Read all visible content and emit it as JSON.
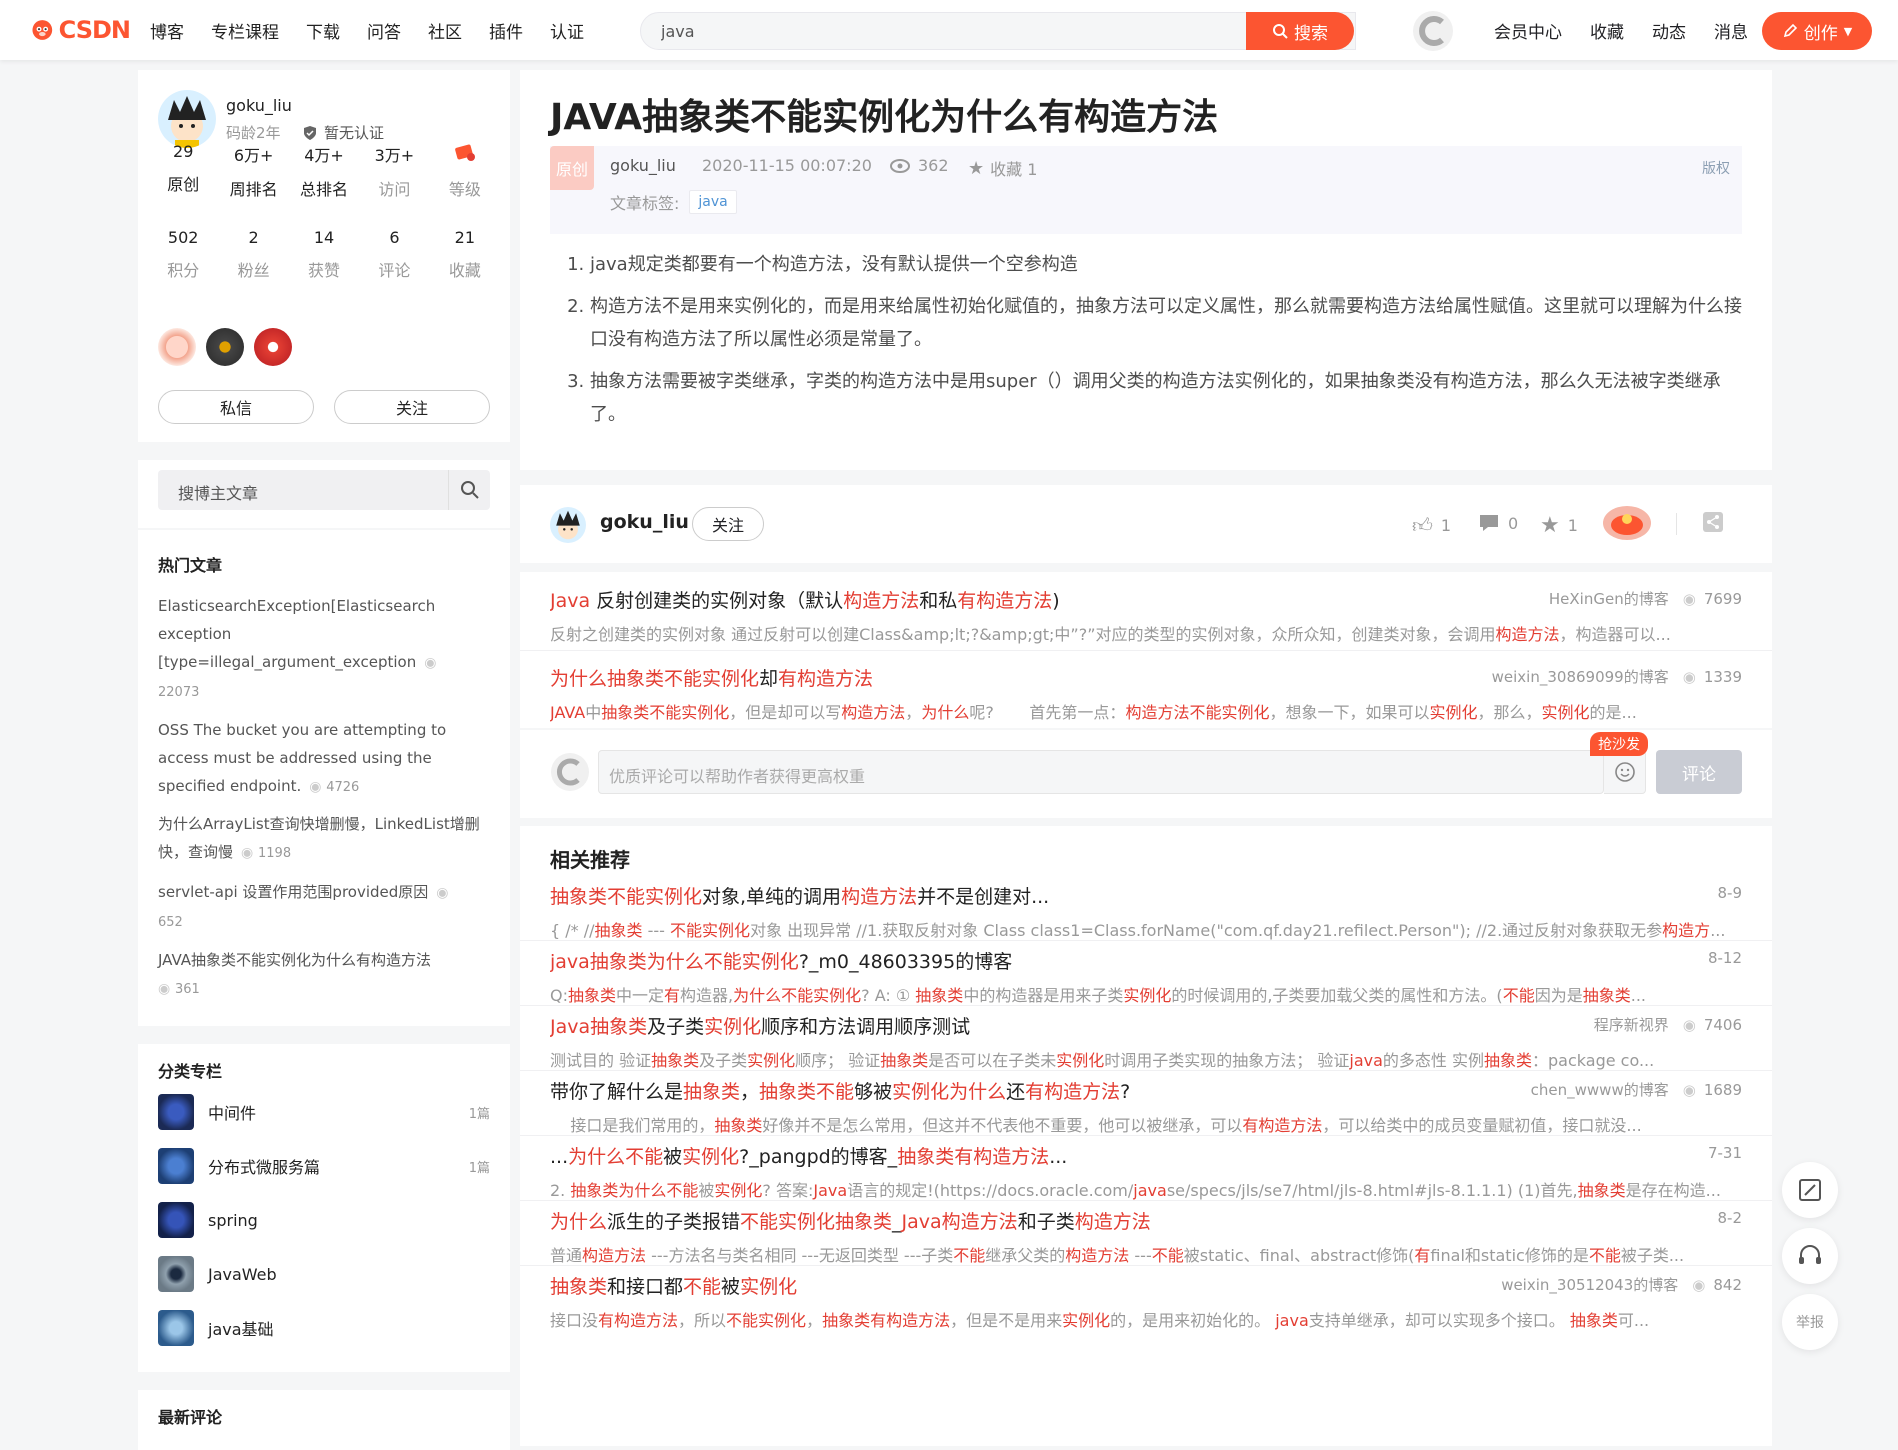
{
  "topbar": {
    "logo_text": "CSDN",
    "nav": [
      "博客",
      "专栏课程",
      "下载",
      "问答",
      "社区",
      "插件",
      "认证"
    ],
    "search_value": "java",
    "search_button": "搜索",
    "links": [
      "会员中心",
      "收藏",
      "动态",
      "消息"
    ],
    "create_button": "创作"
  },
  "profile": {
    "name": "goku_liu",
    "years": "码龄2年",
    "cert": "暂无认证",
    "stats1": [
      {
        "n": "29",
        "l": "原创"
      },
      {
        "n": "6万+",
        "l": "周排名"
      },
      {
        "n": "4万+",
        "l": "总排名"
      },
      {
        "n": "3万+",
        "l": "访问"
      },
      {
        "n": "",
        "l": "等级"
      }
    ],
    "stats2": [
      {
        "n": "502",
        "l": "积分"
      },
      {
        "n": "2",
        "l": "粉丝"
      },
      {
        "n": "14",
        "l": "获赞"
      },
      {
        "n": "6",
        "l": "评论"
      },
      {
        "n": "21",
        "l": "收藏"
      }
    ],
    "message_button": "私信",
    "follow_button": "关注"
  },
  "blogger_search": {
    "placeholder": "搜博主文章"
  },
  "hot_articles": {
    "title": "热门文章",
    "items": [
      {
        "title": "ElasticsearchException[Elasticsearch exception [type=illegal_argument_exception",
        "views": "22073"
      },
      {
        "title": "OSS The bucket you are attempting to access must be addressed using the specified endpoint.",
        "views": "4726"
      },
      {
        "title": "为什么ArrayList查询快增删慢，LinkedList增删快，查询慢",
        "views": "1198"
      },
      {
        "title": "servlet-api 设置作用范围provided原因",
        "views": "652"
      },
      {
        "title": "JAVA抽象类不能实例化为什么有构造方法",
        "views": "361"
      }
    ]
  },
  "categories": {
    "title": "分类专栏",
    "items": [
      {
        "name": "中间件",
        "count": "1篇",
        "color": "#1b2a55"
      },
      {
        "name": "分布式微服务篇",
        "count": "1篇",
        "color": "#1d3f74"
      },
      {
        "name": "spring",
        "count": "",
        "color": "#13214a"
      },
      {
        "name": "JavaWeb",
        "count": "",
        "color": "#6b7a86"
      },
      {
        "name": "java基础",
        "count": "",
        "color": "#2c5b8c"
      }
    ]
  },
  "latest_comments": {
    "title": "最新评论"
  },
  "article": {
    "title": "JAVA抽象类不能实例化为什么有构造方法",
    "badge": "原创",
    "author": "goku_liu",
    "date": "2020-11-15 00:07:20",
    "views": "362",
    "favorites": "收藏 1",
    "copyright": "版权",
    "tags_label": "文章标签:",
    "tag": "java",
    "paragraphs": [
      "java规定类都要有一个构造方法，没有默认提供一个空参构造",
      "构造方法不是用来实例化的，而是用来给属性初始化赋值的，抽象方法可以定义属性，那么就需要构造方法给属性赋值。这里就可以理解为什么接口没有构造方法了所以属性必须是常量了。",
      "抽象方法需要被字类继承，字类的构造方法中是用super（）调用父类的构造方法实例化的，如果抽象类没有构造方法，那么久无法被字类继承了。"
    ]
  },
  "toolbar": {
    "author": "goku_liu",
    "follow": "关注",
    "likes": "1",
    "comments": "0",
    "favorites": "1"
  },
  "related_top": [
    {
      "title_html": "<span class='hl'>Java</span> 反射创建类的实例对象（默认<span class='hl'>构造方法</span>和私<span class='hl'>有构造方法</span>)",
      "source": "HeXinGen的博客",
      "views": "7699",
      "desc_html": "反射之创建类的实例对象 通过反射可以创建Class&amp;amp;lt;?&amp;amp;gt;中”?”对应的类型的实例对象，众所众知，创建类对象，会调用<span class='hl'>构造方法</span>，构造器可以..."
    },
    {
      "title_html": "<span class='hl'>为什么抽象类不能实例化</span>却<span class='hl'>有构造方法</span>",
      "source": "weixin_30869099的博客",
      "views": "1339",
      "desc_html": "<span class='hl'>JAVA</span>中<span class='hl'>抽象类不能实例化</span>，但是却可以写<span class='hl'>构造方法</span>，<span class='hl'>为什么</span>呢?&nbsp;&nbsp;&nbsp;&nbsp;&nbsp;&nbsp;&nbsp;首先第一点：<span class='hl'>构造方法不能实例化</span>，想象一下，如果可以<span class='hl'>实例化</span>，那么，<span class='hl'>实例化</span>的是..."
    }
  ],
  "comment_box": {
    "placeholder": "优质评论可以帮助作者获得更高权重",
    "sofa": "抢沙发",
    "submit": "评论"
  },
  "recommend": {
    "title": "相关推荐",
    "items": [
      {
        "title_html": "<span class='hl'>抽象类不能实例化</span>对象,单纯的调用<span class='hl'>构造方法</span>并不是创建对...",
        "meta": "8-9",
        "views": "",
        "desc_html": "{ /* //<span class='hl'>抽象类</span> --- <span class='hl'>不能实例化</span>对象 出现异常 //1.获取反射对象 Class class1=Class.forName(\"com.qf.day21.refilect.Person\"); //2.通过反射对象获取无参<span class='hl'>构造方</span>..."
      },
      {
        "title_html": "<span class='hl'>java抽象类为什么不能实例化</span>?_m0_48603395的博客",
        "meta": "8-12",
        "views": "",
        "desc_html": "Q:<span class='hl'>抽象类</span>中一定<span class='hl'>有</span>构造器,<span class='hl'>为什么不能实例化</span>? A: ① <span class='hl'>抽象类</span>中的构造器是用来子类<span class='hl'>实例化</span>的时候调用的,子类要加载父类的属性和方法。(<span class='hl'>不能</span>因为是<span class='hl'>抽象类</span>..."
      },
      {
        "title_html": "<span class='hl'>Java抽象类</span>及子类<span class='hl'>实例化</span>顺序和方法调用顺序测试",
        "meta": "程序新视界",
        "views": "7406",
        "desc_html": "测试目的 验证<span class='hl'>抽象类</span>及子类<span class='hl'>实例化</span>顺序； 验证<span class='hl'>抽象类</span>是否可以在子类未<span class='hl'>实例化</span>时调用子类实现的抽象方法； 验证<span class='hl'>java</span>的多态性 实例<span class='hl'>抽象类</span>：package co..."
      },
      {
        "title_html": "带你了解什么是<span class='hl'>抽象类</span>，<span class='hl'>抽象类不能</span>够被<span class='hl'>实例化为什么</span>还<span class='hl'>有构造方法</span>?",
        "meta": "chen_wwww的博客",
        "views": "1689",
        "desc_html": "&nbsp;&nbsp;&nbsp;&nbsp;接口是我们常用的，<span class='hl'>抽象类</span>好像并不是怎么常用，但这并不代表他不重要，他可以被继承，可以<span class='hl'>有构造方法</span>，可以给类中的成员变量赋初值，接口就没..."
      },
      {
        "title_html": "...<span class='hl'>为什么不能</span>被<span class='hl'>实例化</span>?_pangpd的博客_<span class='hl'>抽象类有构造方法</span>...",
        "meta": "7-31",
        "views": "",
        "desc_html": "2. <span class='hl'>抽象类为什么不能</span>被<span class='hl'>实例化</span>? 答案:<span class='hl'>Java</span>语言的规定!(https://docs.oracle.com/<span class='hl'>java</span>se/specs/jls/se7/html/jls-8.html#jls-8.1.1.1) (1)首先,<span class='hl'>抽象类</span>是存在构造..."
      },
      {
        "title_html": "<span class='hl'>为什么</span>派生的子类报错<span class='hl'>不能实例化抽象类</span>_<span class='hl'>Java构造方法</span>和子类<span class='hl'>构造方法</span>",
        "meta": "8-2",
        "views": "",
        "desc_html": "普通<span class='hl'>构造方法</span> ---方法名与类名相同 ---无返回类型 ---子类<span class='hl'>不能</span>继承父类的<span class='hl'>构造方法</span> ---<span class='hl'>不能</span>被static、final、abstract修饰(<span class='hl'>有</span>final和static修饰的是<span class='hl'>不能</span>被子类..."
      },
      {
        "title_html": "<span class='hl'>抽象类</span>和接口都<span class='hl'>不能</span>被<span class='hl'>实例化</span>",
        "meta": "weixin_30512043的博客",
        "views": "842",
        "desc_html": "接口没<span class='hl'>有构造方法</span>，所以<span class='hl'>不能实例化</span>，<span class='hl'>抽象类有构造方法</span>，但是不是用来<span class='hl'>实例化</span>的，是用来初始化的。 <span class='hl'>java</span>支持单继承，却可以实现多个接口。 <span class='hl'>抽象类</span>可..."
      }
    ]
  },
  "float": {
    "report": "举报"
  },
  "colors": {
    "brand": "#fc5531",
    "highlight": "#e33e33"
  }
}
